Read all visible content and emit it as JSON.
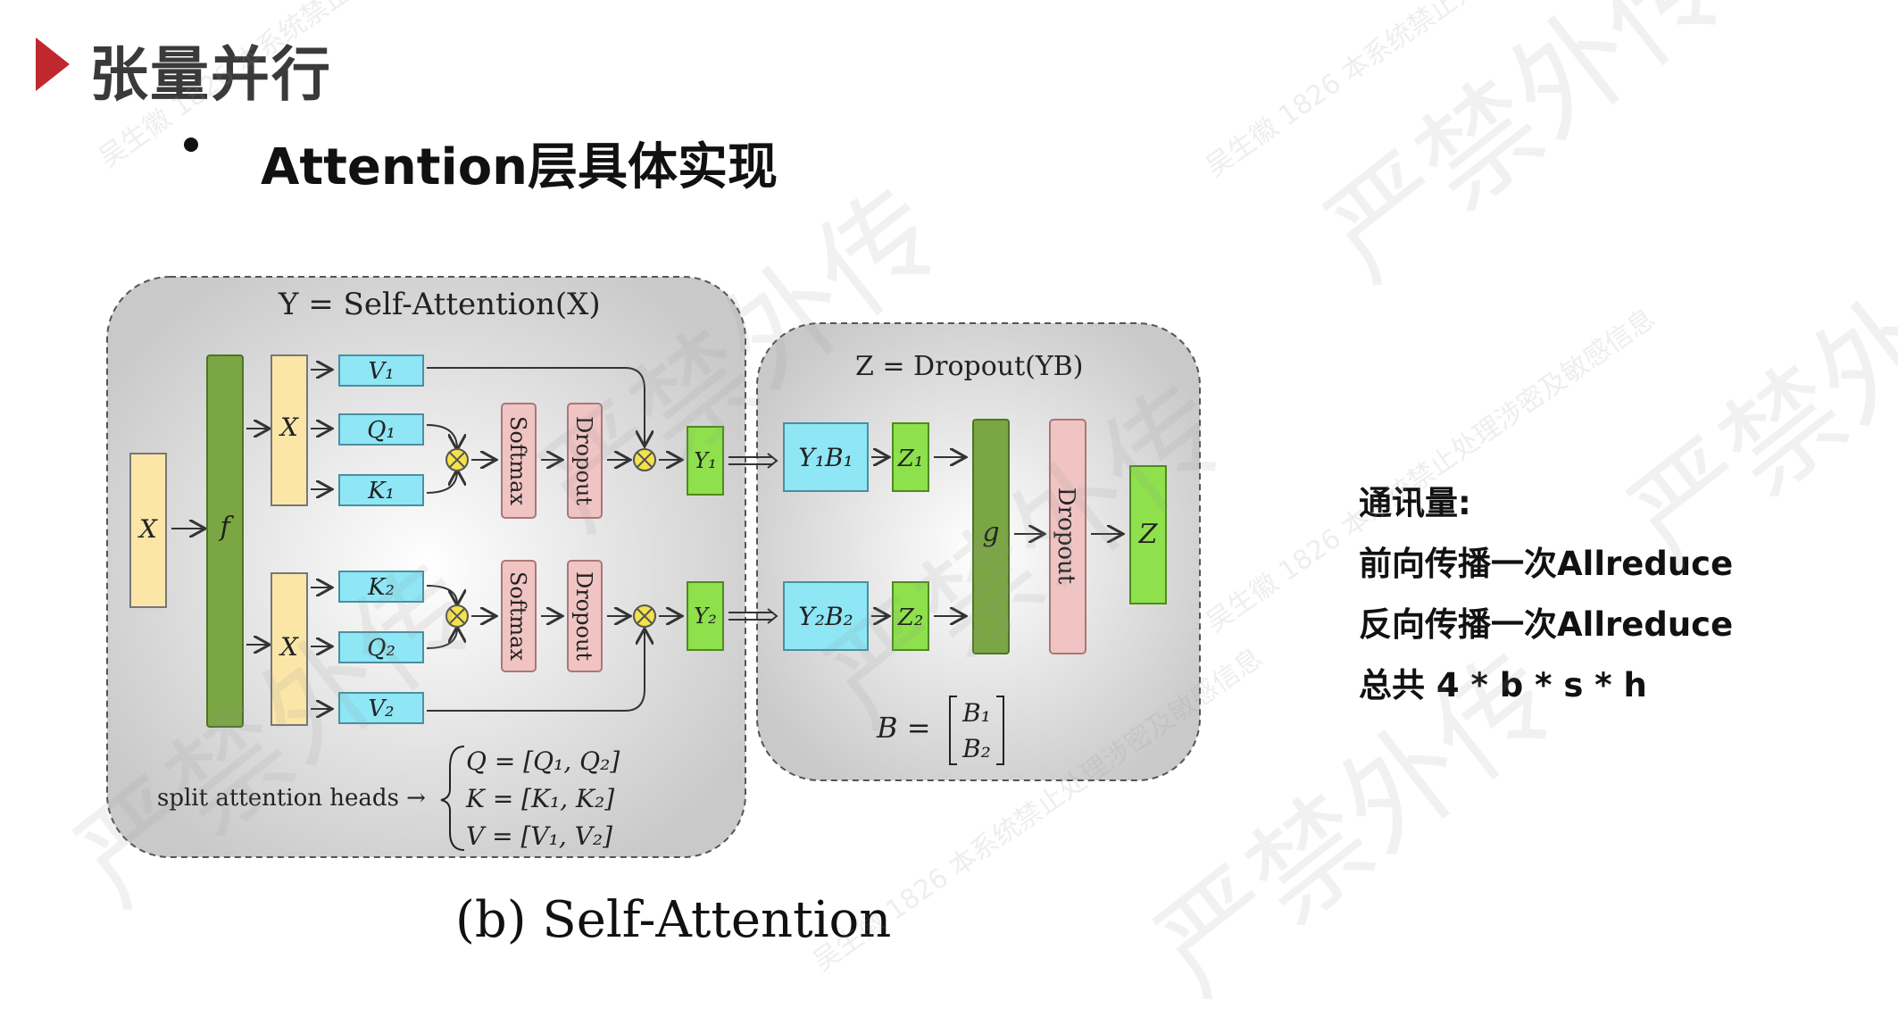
{
  "slide": {
    "title": "张量并行",
    "bullet": "Attention层具体实现",
    "caption": "(b) Self-Attention"
  },
  "communication": {
    "heading": "通讯量:",
    "lines": [
      "前向传播一次Allreduce",
      "反向传播一次Allreduce",
      "总共 4 * b * s * h"
    ]
  },
  "diagram": {
    "left_panel_title": "Y = Self-Attention(X)",
    "right_panel_title": "Z = Dropout(YB)",
    "input_label": "X",
    "f_label": "f",
    "g_label": "g",
    "head1": {
      "x": "X",
      "v": "V₁",
      "q": "Q₁",
      "k": "K₁",
      "softmax": "Softmax",
      "dropout": "Dropout",
      "y": "Y₁",
      "yb": "Y₁B₁",
      "z": "Z₁"
    },
    "head2": {
      "x": "X",
      "k": "K₂",
      "q": "Q₂",
      "v": "V₂",
      "softmax": "Softmax",
      "dropout": "Dropout",
      "y": "Y₂",
      "yb": "Y₂B₂",
      "z": "Z₂"
    },
    "right_dropout": "Dropout",
    "output_label": "Z",
    "split_label": "split attention heads →",
    "split_q": "Q = [Q₁, Q₂]",
    "split_k": "K = [K₁, K₂]",
    "split_v": "V = [V₁, V₂]",
    "b_label": "B =",
    "b_row1": "B₁",
    "b_row2": "B₂"
  },
  "watermark": {
    "big": "严禁外传",
    "small": "吴生徽 1826 本系统禁止处理涉密及敏感信息"
  },
  "colors": {
    "accent": "#c0282d",
    "yellow": "#fbe6a8",
    "green": "#7aa743",
    "cyan": "#8fe6f5",
    "pink": "#f1c4c4",
    "lime": "#8ee04c"
  }
}
